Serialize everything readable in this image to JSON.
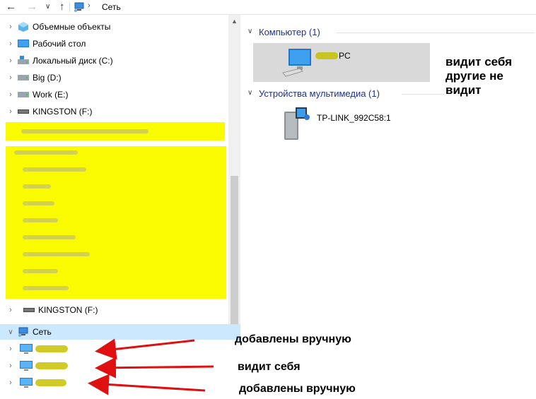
{
  "address_bar": {
    "crumb": "Сеть"
  },
  "tree": {
    "items": [
      {
        "label": "Объемные объекты",
        "icon": "3d-objects-icon"
      },
      {
        "label": "Рабочий стол",
        "icon": "desktop-icon"
      },
      {
        "label": "Локальный диск (C:)",
        "icon": "drive-icon"
      },
      {
        "label": "Big (D:)",
        "icon": "drive-icon"
      },
      {
        "label": "Work (E:)",
        "icon": "drive-icon"
      },
      {
        "label": "KINGSTON (F:)",
        "icon": "usb-drive-icon"
      }
    ],
    "kingston_bottom": "KINGSTON (F:)",
    "network": "Сеть"
  },
  "content": {
    "group_computer": "Компьютер (1)",
    "computer_name": "PC",
    "group_media": "Устройства мультимедиа (1)",
    "media_name": "TP-LINK_992C58:1"
  },
  "annotations": {
    "note_top": "видит себя\nдругие не\nвидит",
    "note_1": "добавлены вручную",
    "note_2": "видит себя",
    "note_3": "добавлены вручную"
  },
  "colors": {
    "highlight": "#fbfb00",
    "arrow": "#e01010",
    "selection": "#cce8ff"
  }
}
